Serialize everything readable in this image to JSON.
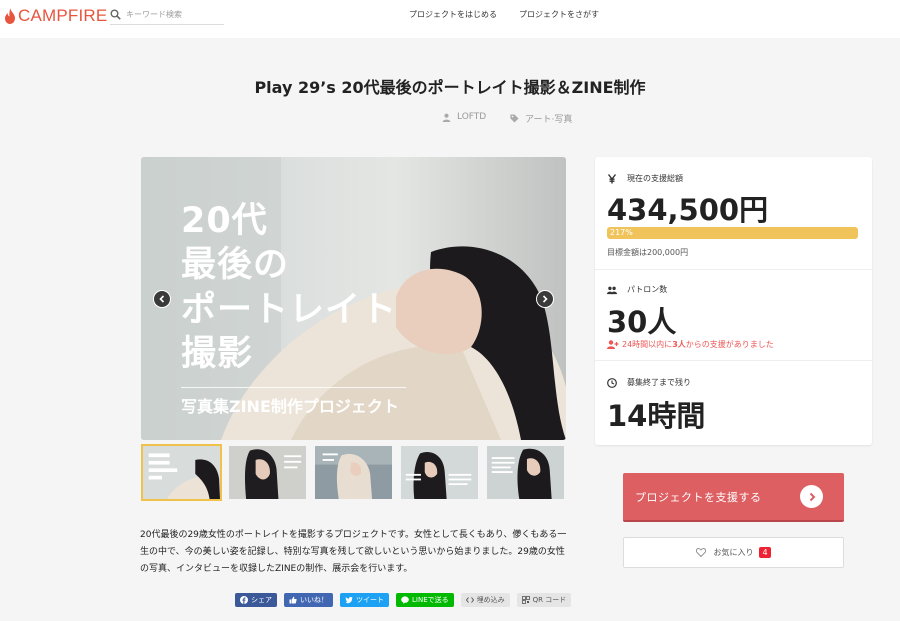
{
  "header": {
    "logo_text": "CAMPFIRE",
    "search_placeholder": "キーワード検索",
    "nav": [
      "プロジェクトをはじめる",
      "プロジェクトをさがす"
    ]
  },
  "project": {
    "title": "Play 29’s 20代最後のポートレイト撮影＆ZINE制作",
    "author": "LOFTD",
    "category": "アート·写真"
  },
  "hero": {
    "lines": [
      "20代",
      "最後の",
      "ポートレイト",
      "撮影"
    ],
    "subtitle": "写真集ZINE制作プロジェクト"
  },
  "thumbnails": 5,
  "description": "20代最後の29歳女性のポートレイトを撮影するプロジェクトです。女性として長くもあり、儚くもある一生の中で、今の美しい姿を記録し、特別な写真を残して欲しいという思いから始まりました。29歳の女性の写真、インタビューを収録したZINEの制作、展示会を行います。",
  "share": [
    {
      "label": "シェア",
      "color": "#3b5998"
    },
    {
      "label": "いいね！",
      "color": "#4267b2"
    },
    {
      "label": "ツイート",
      "color": "#1da1f2"
    },
    {
      "label": "LINEで送る",
      "color": "#00b900"
    },
    {
      "label": "埋め込み",
      "color": "#e5e5e5"
    },
    {
      "label": "QR コード",
      "color": "#e5e5e5"
    }
  ],
  "stats": {
    "amount_label": "現在の支援総額",
    "amount": "434,500円",
    "progress": "217%",
    "goal": "目標金額は200,000円",
    "patrons_label": "パトロン数",
    "patrons": "30人",
    "recent_pre": "24時間以内に",
    "recent_num": "3人",
    "recent_post": "からの支援がありました",
    "remaining_label": "募集終了まで残り",
    "remaining": "14時間"
  },
  "actions": {
    "support_label": "プロジェクトを支援する",
    "favorite_label": "お気に入り",
    "favorite_count": "4"
  },
  "colors": {
    "brand": "#e8553e",
    "support_button": "#dd5f62",
    "progress_bar": "#f0c45b"
  }
}
